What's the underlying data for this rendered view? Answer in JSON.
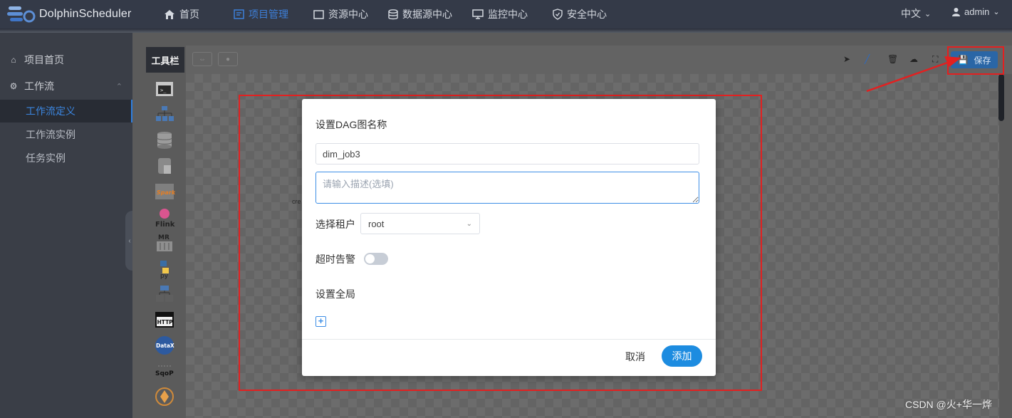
{
  "app": {
    "name": "DolphinScheduler"
  },
  "nav": {
    "items": [
      {
        "label": "首页",
        "icon": "home-icon"
      },
      {
        "label": "项目管理",
        "icon": "project-icon",
        "active": true
      },
      {
        "label": "资源中心",
        "icon": "folder-icon"
      },
      {
        "label": "数据源中心",
        "icon": "database-icon"
      },
      {
        "label": "监控中心",
        "icon": "monitor-icon"
      },
      {
        "label": "安全中心",
        "icon": "shield-icon"
      }
    ],
    "language": "中文",
    "user": "admin"
  },
  "sidebar": {
    "items": [
      {
        "label": "项目首页",
        "icon": "home-icon"
      },
      {
        "label": "工作流",
        "icon": "gear-icon",
        "expanded": true
      }
    ],
    "sub_items": [
      {
        "label": "工作流定义",
        "active": true
      },
      {
        "label": "工作流实例"
      },
      {
        "label": "任务实例"
      }
    ]
  },
  "canvas": {
    "toolbar_label": "工具栏",
    "save_label": "保存",
    "partial_text": "cre",
    "tools": [
      "shell",
      "sub-process",
      "procedure",
      "sql",
      "spark",
      "flink",
      "mr",
      "python",
      "dependent",
      "http",
      "datax",
      "sqoop",
      "conditions"
    ],
    "tool_labels": {
      "flink": "Flink",
      "mr": "MR",
      "python": "py",
      "http": "HTTP",
      "datax": "DataX",
      "sqoop": "SqoP"
    }
  },
  "dialog": {
    "title": "设置DAG图名称",
    "name_value": "dim_job3",
    "description_placeholder": "请输入描述(选填)",
    "tenant_label": "选择租户",
    "tenant_value": "root",
    "timeout_label": "超时告警",
    "timeout_enabled": false,
    "global_label": "设置全局",
    "cancel_label": "取消",
    "add_label": "添加"
  },
  "watermark": "CSDN @火+华一烨",
  "colors": {
    "topbar": "#343a48",
    "sidebar": "#3a3e47",
    "accent": "#1d8ce0",
    "annotation": "#e32020"
  }
}
